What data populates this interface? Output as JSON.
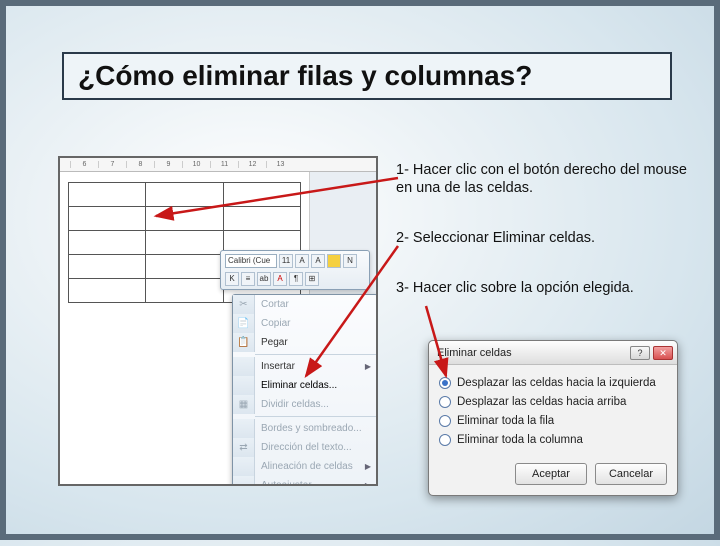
{
  "title": "¿Cómo eliminar filas y columnas?",
  "steps": {
    "s1": "1- Hacer clic con el botón derecho del mouse en una de las celdas.",
    "s2": "2- Seleccionar  Eliminar celdas.",
    "s3": "3- Hacer clic sobre la opción elegida."
  },
  "word": {
    "ruler_ticks": [
      "6",
      "7",
      "8",
      "9",
      "10",
      "11",
      "12",
      "13"
    ],
    "mini_toolbar": {
      "font": "Calibri (Cue",
      "buttons": [
        "N",
        "K"
      ]
    }
  },
  "context_menu": {
    "items": [
      {
        "icon": "✂",
        "label": "Cortar",
        "disabled": true
      },
      {
        "icon": "📄",
        "label": "Copiar",
        "disabled": true
      },
      {
        "icon": "📋",
        "label": "Pegar",
        "disabled": false
      },
      {
        "sep": true
      },
      {
        "icon": "",
        "label": "Insertar",
        "submenu": true
      },
      {
        "icon": "",
        "label": "Eliminar celdas...",
        "hot": true
      },
      {
        "icon": "▦",
        "label": "Dividir celdas...",
        "disabled": true
      },
      {
        "sep": true
      },
      {
        "icon": "",
        "label": "Bordes y sombreado...",
        "disabled": true
      },
      {
        "icon": "⇄",
        "label": "Dirección del texto...",
        "disabled": true
      },
      {
        "icon": "",
        "label": "Alineación de celdas",
        "submenu": true,
        "disabled": true
      },
      {
        "icon": "",
        "label": "Autoajustar",
        "submenu": true,
        "disabled": true
      }
    ]
  },
  "dialog": {
    "title": "Eliminar celdas",
    "options": {
      "o1": "Desplazar las celdas hacia la izquierda",
      "o2": "Desplazar las celdas hacia arriba",
      "o3": "Eliminar toda la fila",
      "o4": "Eliminar toda la columna"
    },
    "selected": 0,
    "ok": "Aceptar",
    "cancel": "Cancelar",
    "help_glyph": "?",
    "close_glyph": "✕"
  }
}
